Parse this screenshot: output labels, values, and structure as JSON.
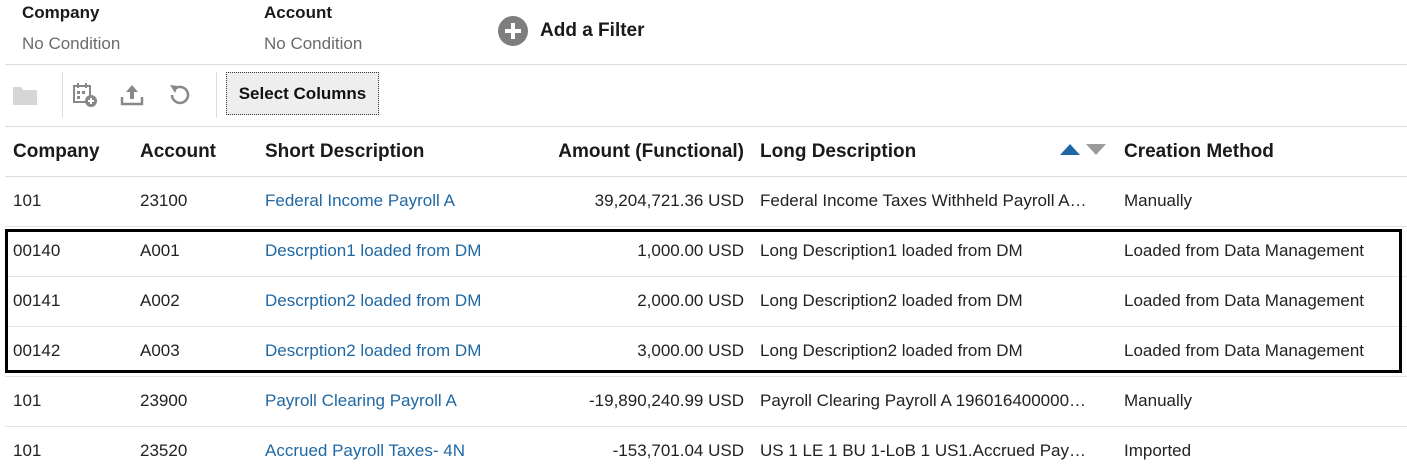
{
  "filters": [
    {
      "name": "Company",
      "value": "No Condition"
    },
    {
      "name": "Account",
      "value": "No Condition"
    }
  ],
  "add_filter_label": "Add a Filter",
  "toolbar": {
    "icons": [
      "folder-icon",
      "add-calendar-icon",
      "upload-icon",
      "refresh-icon"
    ],
    "select_columns_label": "Select Columns"
  },
  "table": {
    "columns": [
      "Company",
      "Account",
      "Short Description",
      "Amount (Functional)",
      "Long Description",
      "Creation Method"
    ],
    "sort": {
      "column": "Long Description",
      "direction": "ascending"
    },
    "rows": [
      [
        "101",
        "23100",
        "Federal Income Payroll A",
        "39,204,721.36 USD",
        "Federal Income Taxes Withheld Payroll A…",
        "Manually"
      ],
      [
        "00140",
        "A001",
        "Descrption1 loaded from DM",
        "1,000.00 USD",
        "Long Description1 loaded from DM",
        "Loaded from Data Management"
      ],
      [
        "00141",
        "A002",
        "Descrption2 loaded from DM",
        "2,000.00 USD",
        "Long Description2 loaded from DM",
        "Loaded from Data Management"
      ],
      [
        "00142",
        "A003",
        "Descrption2 loaded from DM",
        "3,000.00 USD",
        "Long Description2 loaded from DM",
        "Loaded from Data Management"
      ],
      [
        "101",
        "23900",
        "Payroll Clearing Payroll A",
        "-19,890,240.99 USD",
        "Payroll Clearing Payroll A 196016400000…",
        "Manually"
      ],
      [
        "101",
        "23520",
        "Accrued Payroll Taxes- 4N",
        "-153,701.04 USD",
        "US 1 LE 1 BU 1-LoB 1 US1.Accrued Pay…",
        "Imported"
      ]
    ]
  },
  "colors": {
    "link": "#1f68a4",
    "sort_active": "#1f68a4",
    "highlight_border": "#000000"
  }
}
